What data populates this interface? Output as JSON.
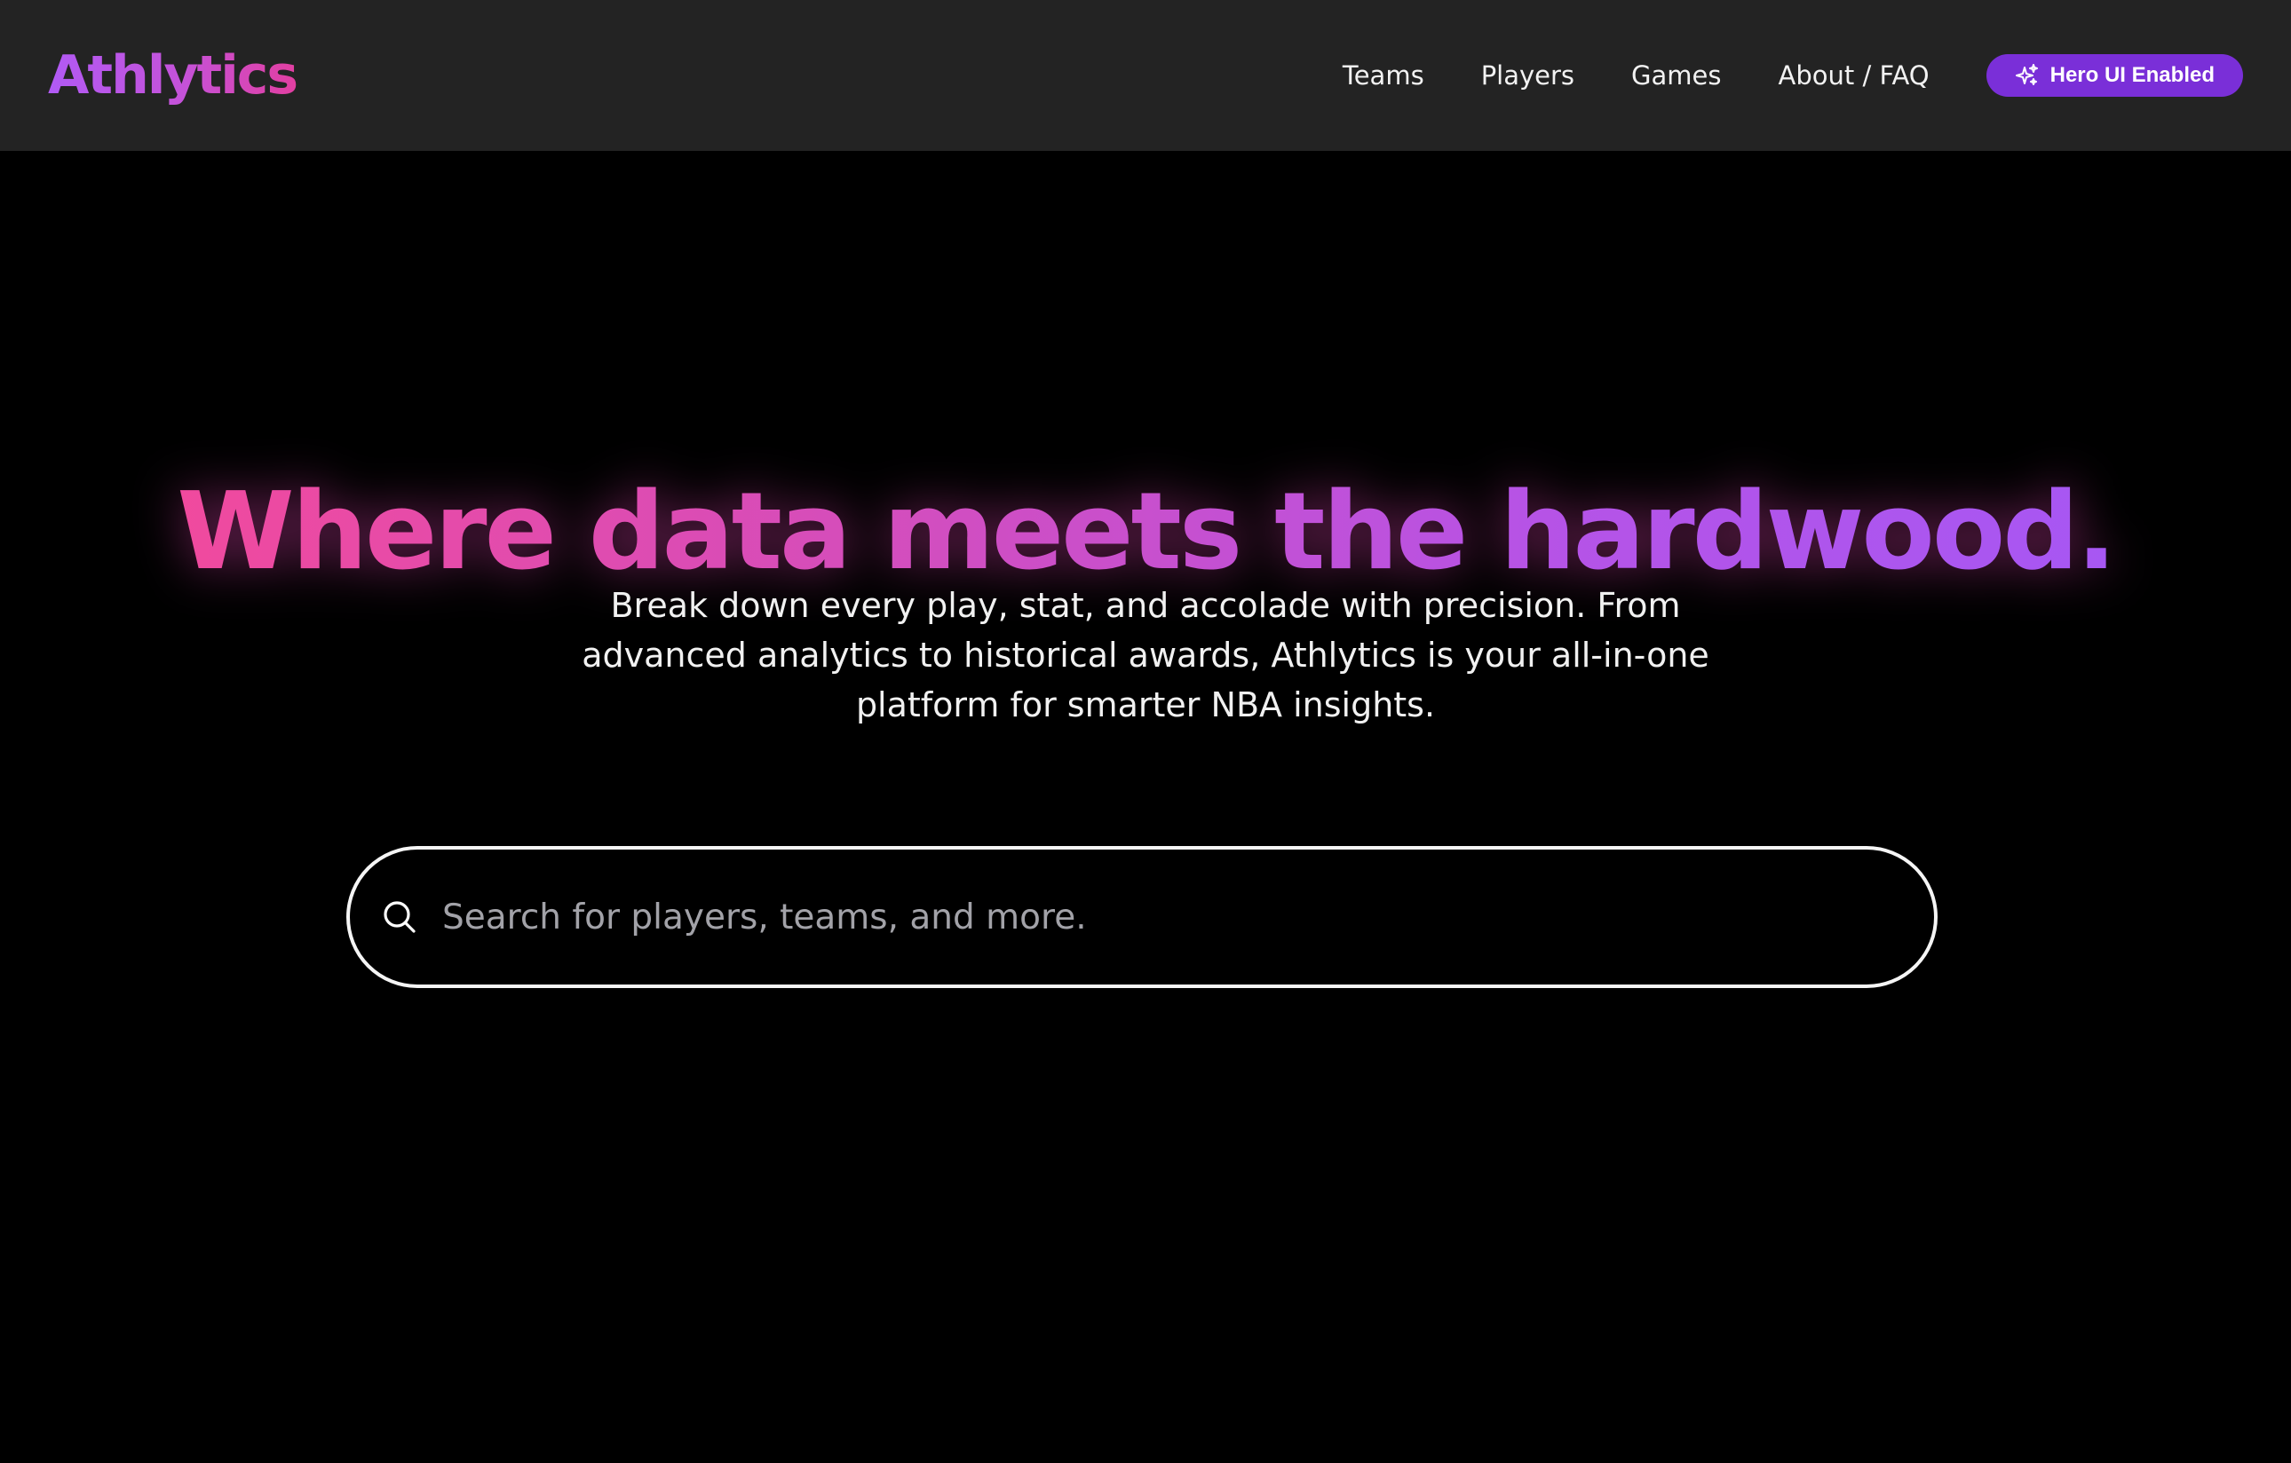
{
  "navbar": {
    "logo": "Athlytics",
    "links": [
      {
        "label": "Teams"
      },
      {
        "label": "Players"
      },
      {
        "label": "Games"
      },
      {
        "label": "About / FAQ"
      }
    ],
    "hero_ui_button": {
      "label": "Hero UI Enabled",
      "icon": "sparkles-icon"
    }
  },
  "hero": {
    "headline": "Where data meets the hardwood.",
    "subtext": "Break down every play, stat, and accolade with precision. From advanced analytics to historical awards, Athlytics is your all-in-one platform for smarter NBA insights."
  },
  "search": {
    "placeholder": "Search for players, teams, and more.",
    "value": "",
    "icon": "search-icon"
  },
  "colors": {
    "background": "#000000",
    "navbar": "#232323",
    "accent_purple": "#7a2fd8",
    "gradient_pink": "#f04a9e",
    "gradient_purple": "#a757f3"
  }
}
